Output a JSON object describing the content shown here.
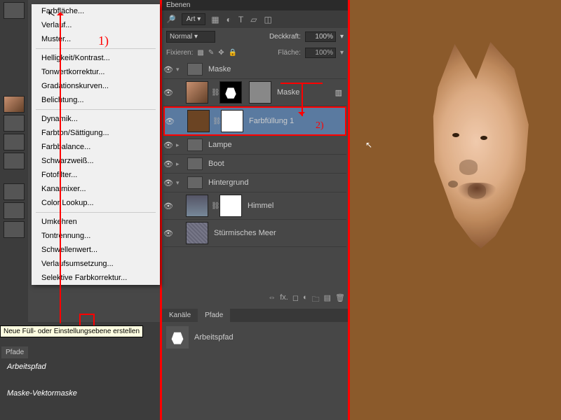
{
  "menu": {
    "items": [
      "Farbfläche...",
      "Verlauf...",
      "Muster...",
      "Helligkeit/Kontrast...",
      "Tonwertkorrektur...",
      "Gradationskurven...",
      "Belichtung...",
      "Dynamik...",
      "Farbton/Sättigung...",
      "Farbbalance...",
      "Schwarzweiß...",
      "Fotofilter...",
      "Kanalmixer...",
      "Color Lookup...",
      "Umkehren",
      "Tontrennung...",
      "Schwellenwert...",
      "Verlaufsumsetzung...",
      "Selektive Farbkorrektur..."
    ]
  },
  "anno": {
    "one": "1)",
    "two": "2)"
  },
  "left": {
    "tooltip": "Neue Füll- oder Einstellungsebene erstellen",
    "tab": "Pfade",
    "path": "Arbeitspfad",
    "mask": "Maske-Vektormaske"
  },
  "panel": {
    "title": "Ebenen",
    "art": "Art",
    "blend": "Normal",
    "opLabel": "Deckkraft:",
    "op": "100%",
    "fillLabel": "Fläche:",
    "fill": "100%",
    "lock": "Fixieren:"
  },
  "layers": {
    "g1": "Maske",
    "l1": "Maske",
    "l2": "Farbfüllung 1",
    "l3": "Lampe",
    "l4": "Boot",
    "g2": "Hintergrund",
    "l5": "Himmel",
    "l6": "Stürmisches Meer"
  },
  "tabs": {
    "k": "Kanäle",
    "p": "Pfade"
  },
  "paths": {
    "work": "Arbeitspfad"
  }
}
